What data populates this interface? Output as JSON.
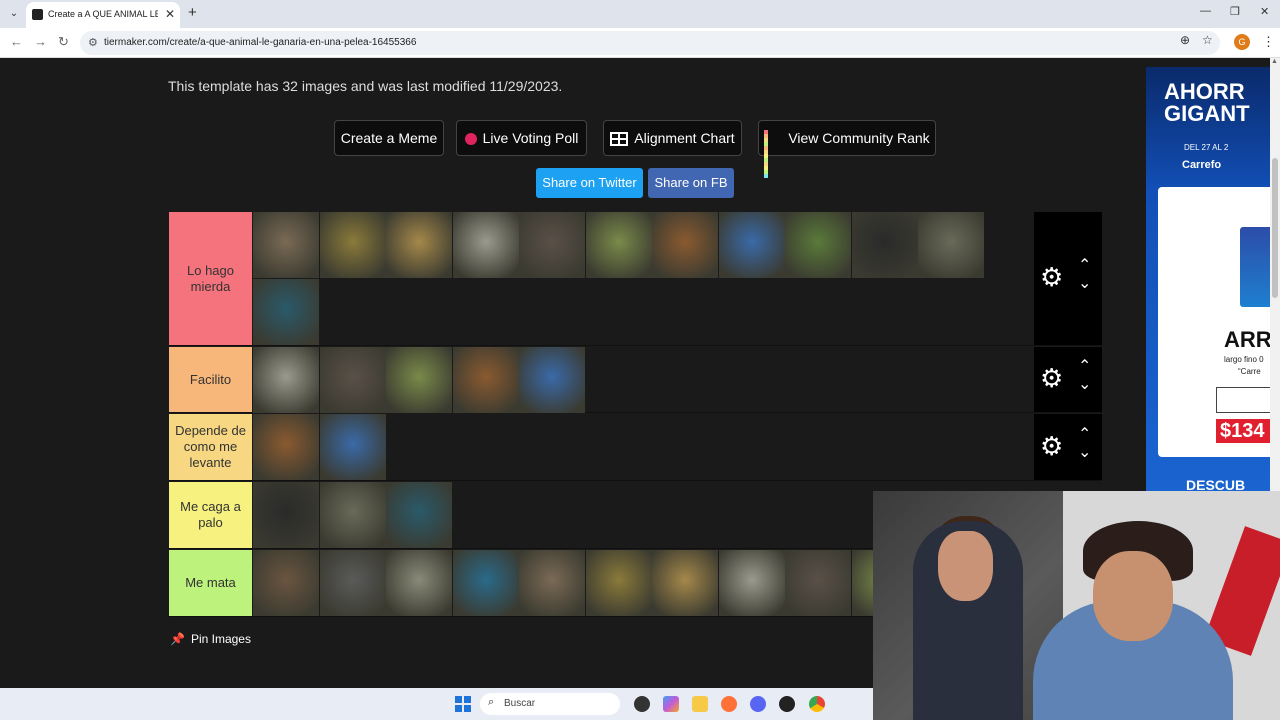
{
  "browser": {
    "tab_title": "Create a A QUE ANIMAL LE GANARIA",
    "url": "tiermaker.com/create/a-que-animal-le-ganaria-en-una-pelea-16455366"
  },
  "page": {
    "info_text": "This template has 32 images and was last modified 11/29/2023.",
    "buttons": {
      "meme": "Create a Meme",
      "poll": "Live Voting Poll",
      "alignment": "Alignment Chart",
      "community": "View Community Rank",
      "twitter": "Share on Twitter",
      "fb": "Share on FB"
    },
    "pin_label": "Pin Images"
  },
  "tiers": [
    {
      "label": "Lo hago mierda",
      "color": "#f4737c",
      "items": [
        "hedgehog",
        "hen",
        "guinea-pig",
        "sheep",
        "platypus",
        "squirrel",
        "scorpion",
        "penguin",
        "otter",
        "panda",
        "piranha",
        "octopus"
      ]
    },
    {
      "label": "Facilito",
      "color": "#f8b77a",
      "items": [
        "donkey",
        "eagle",
        "goat",
        "snake",
        "fox"
      ]
    },
    {
      "label": "Depende de como me levante",
      "color": "#f7d782",
      "items": [
        "wolf",
        "cow"
      ]
    },
    {
      "label": "Me caga a palo",
      "color": "#f7f27f",
      "items": [
        "kangaroo",
        "boar",
        "moose"
      ]
    },
    {
      "label": "Me mata",
      "color": "#bdf27c",
      "items": [
        "crocodile",
        "gorilla",
        "dolphin",
        "komodo-dragon",
        "shark",
        "capybara",
        "lion",
        "rhino",
        "orca",
        "tiger"
      ]
    }
  ],
  "ad": {
    "headline_1": "AHORR",
    "headline_2": "GIGANT",
    "date": "DEL 27 AL 2",
    "brand": "Carrefo",
    "product": "ARR",
    "desc_1": "largo fino 0",
    "desc_2": "“Carre",
    "price": "$134",
    "footer": "DESCUB"
  },
  "taskbar": {
    "search_placeholder": "Buscar"
  },
  "colors": {
    "twitter": "#1da1f2",
    "facebook": "#4267b2",
    "poll_dot": "#e0245e"
  }
}
